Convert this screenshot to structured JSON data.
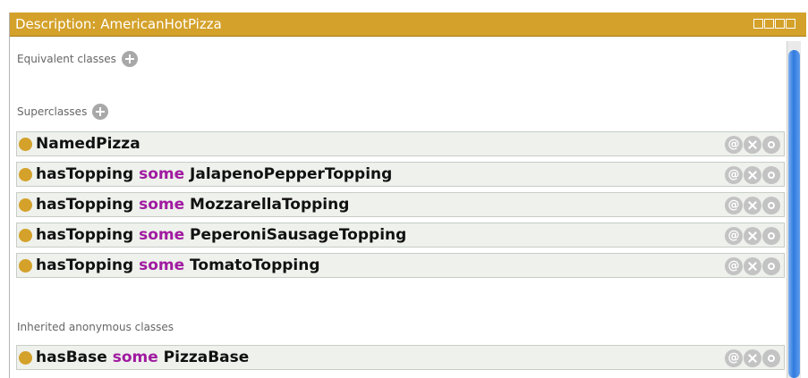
{
  "panel": {
    "title": "Description: AmericanHotPizza",
    "colors": {
      "title_bg": "#d4a12a",
      "keyword": "#a01aa0",
      "class_dot": "#d4a12a",
      "row_bg": "#eef1ec"
    }
  },
  "sections": {
    "equivalent": {
      "label": "Equivalent classes"
    },
    "superclasses": {
      "label": "Superclasses"
    },
    "inherited": {
      "label": "Inherited anonymous classes"
    }
  },
  "superclasses": [
    {
      "property": "",
      "keyword": "",
      "filler": "NamedPizza"
    },
    {
      "property": "hasTopping",
      "keyword": "some",
      "filler": "JalapenoPepperTopping"
    },
    {
      "property": "hasTopping",
      "keyword": "some",
      "filler": "MozzarellaTopping"
    },
    {
      "property": "hasTopping",
      "keyword": "some",
      "filler": "PeperoniSausageTopping"
    },
    {
      "property": "hasTopping",
      "keyword": "some",
      "filler": "TomatoTopping"
    }
  ],
  "inherited": [
    {
      "property": "hasBase",
      "keyword": "some",
      "filler": "PizzaBase"
    }
  ],
  "row_actions": {
    "annotate": "@"
  }
}
